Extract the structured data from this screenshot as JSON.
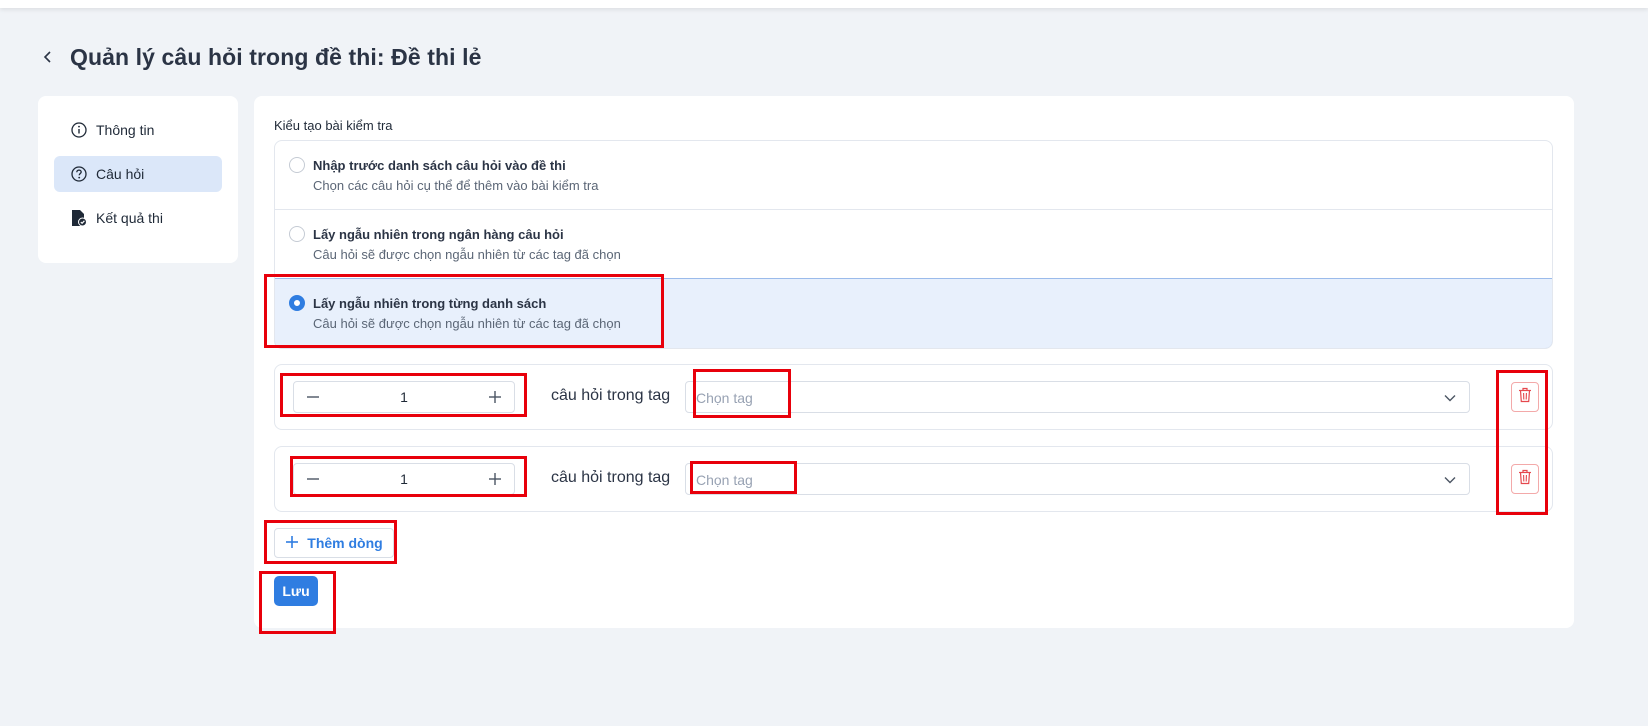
{
  "header": {
    "title": "Quản lý câu hỏi trong đề thi: Đề thi lẻ"
  },
  "sidebar": {
    "items": [
      {
        "label": "Thông tin",
        "icon": "info-icon",
        "active": false
      },
      {
        "label": "Câu hỏi",
        "icon": "question-icon",
        "active": true
      },
      {
        "label": "Kết quả thi",
        "icon": "file-result-icon",
        "active": false
      }
    ]
  },
  "main": {
    "section_label": "Kiểu tạo bài kiểm tra",
    "options": [
      {
        "title": "Nhập trước danh sách câu hỏi vào đề thi",
        "desc": "Chọn các câu hỏi cụ thể để thêm vào bài kiểm tra",
        "selected": false
      },
      {
        "title": "Lấy ngẫu nhiên trong ngân hàng câu hỏi",
        "desc": "Câu hỏi sẽ được chọn ngẫu nhiên từ các tag đã chọn",
        "selected": false
      },
      {
        "title": "Lấy ngẫu nhiên trong từng danh sách",
        "desc": "Câu hỏi sẽ được chọn ngẫu nhiên từ các tag đã chọn",
        "selected": true
      }
    ],
    "rows": [
      {
        "count": "1",
        "text": "câu hỏi trong tag",
        "placeholder": "Chọn tag"
      },
      {
        "count": "1",
        "text": "câu hỏi trong tag",
        "placeholder": "Chọn tag"
      }
    ],
    "add_row_label": "Thêm dòng",
    "save_label": "Lưu"
  },
  "colors": {
    "accent": "#2f7de1",
    "danger": "#e5484d",
    "annotation": "#e8000b",
    "selected_bg": "#e8f0fc"
  }
}
